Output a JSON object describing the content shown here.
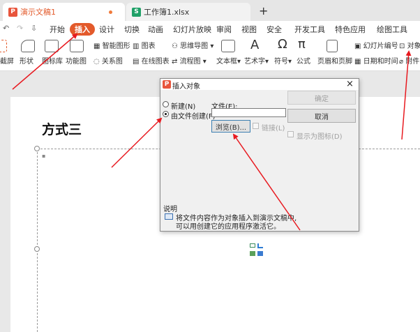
{
  "tabs": {
    "doc_tab": "演示文稿1",
    "sheet_tab": "工作簿1.xlsx",
    "new_tab": "+",
    "doc_badge": "P",
    "sheet_badge": "S"
  },
  "quick_access": {
    "undo": "↶",
    "redo": "↷",
    "more": "⇩"
  },
  "menu": {
    "items": [
      "开始",
      "插入",
      "设计",
      "切换",
      "动画",
      "幻灯片放映",
      "审阅",
      "视图",
      "安全",
      "开发工具",
      "特色应用",
      "绘图工具"
    ],
    "active": "插入"
  },
  "ribbon": {
    "screenshot": "截屏",
    "shapes": "形状",
    "gallery": "图标库",
    "function_chart": "功能图",
    "smart_art": "智能图形",
    "chart": "图表",
    "mind_map": "思维导图",
    "relation": "关系图",
    "online_chart": "在线图表",
    "flowchart": "流程图",
    "textbox": "文本框",
    "wordart": "艺术字",
    "symbol": "符号",
    "formula": "公式",
    "header_footer": "页眉和页脚",
    "slide_number": "幻灯片编号",
    "object": "对象",
    "datetime": "日期和时间",
    "attachment": "附件"
  },
  "slide": {
    "title": "方式三"
  },
  "dialog": {
    "title": "插入对象",
    "title_badge": "P",
    "close": "×",
    "radio_new": "新建(N)",
    "radio_from_file": "由文件创建(F)",
    "file_label": "文件(E):",
    "file_value": "",
    "browse": "浏览(B)...",
    "link": "链接(L)",
    "ok": "确定",
    "cancel": "取消",
    "show_as_icon": "显示为图标(D)",
    "desc_heading": "说明",
    "desc_line1": "将文件内容作为对象插入到演示文稿中,",
    "desc_line2": "可以用创建它的应用程序激活它。"
  },
  "colors": {
    "accent": "#e35a2b",
    "arrow": "#e8191f",
    "doc_badge": "#e8553c",
    "sheet_badge": "#1fa067"
  }
}
